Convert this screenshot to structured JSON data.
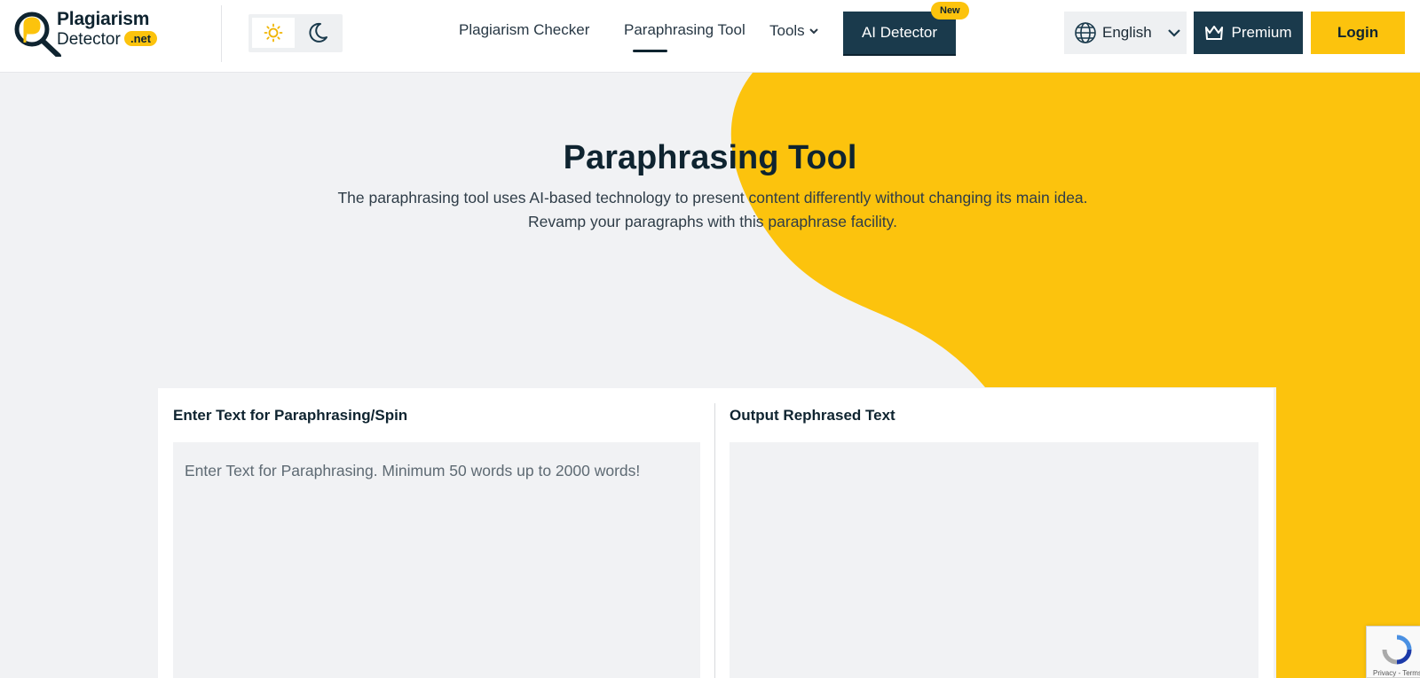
{
  "header": {
    "logo_line1": "Plagiarism",
    "logo_line2": "Detector",
    "logo_badge": ".net",
    "nav": [
      {
        "label": "Plagiarism Checker"
      },
      {
        "label": "Paraphrasing Tool"
      },
      {
        "label": "Tools"
      }
    ],
    "ai_detector_label": "AI Detector",
    "new_badge": "New",
    "language": "English",
    "premium_label": "Premium",
    "login_label": "Login",
    "theme_icons": [
      "sun-icon",
      "moon-icon"
    ]
  },
  "hero": {
    "title": "Paraphrasing Tool",
    "description": "The paraphrasing tool uses AI-based technology to present content differently without changing its main idea. Revamp your paragraphs with this paraphrase facility."
  },
  "editor": {
    "input_label": "Enter Text for Paraphrasing/Spin",
    "input_placeholder": "Enter Text for Paraphrasing. Minimum 50 words up to 2000 words!",
    "input_value": "",
    "output_label": "Output Rephrased Text"
  },
  "recaptcha": {
    "text": "Privacy - Terms"
  },
  "colors": {
    "accent": "#fcc30d",
    "dark": "#1a3a4c",
    "background": "#f1f2f4"
  }
}
